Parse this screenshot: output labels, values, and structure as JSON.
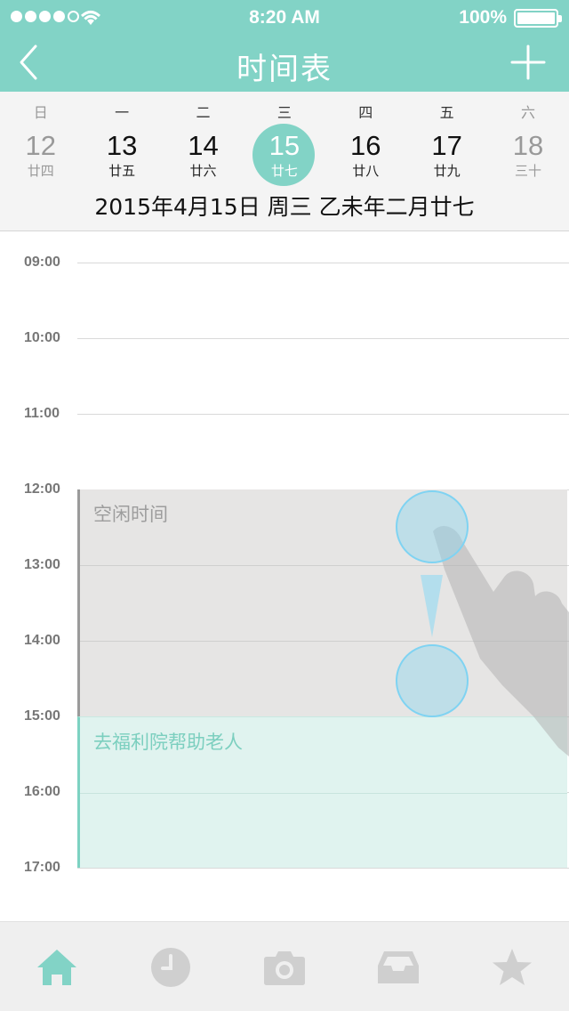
{
  "status_bar": {
    "time": "8:20 AM",
    "battery": "100%"
  },
  "header": {
    "title": "时间表"
  },
  "week": {
    "weekdays": [
      {
        "label": "日",
        "muted": true
      },
      {
        "label": "一",
        "muted": false
      },
      {
        "label": "二",
        "muted": false
      },
      {
        "label": "三",
        "muted": false
      },
      {
        "label": "四",
        "muted": false
      },
      {
        "label": "五",
        "muted": false
      },
      {
        "label": "六",
        "muted": true
      }
    ],
    "days": [
      {
        "num": "12",
        "lunar": "廿四",
        "muted": true,
        "selected": false
      },
      {
        "num": "13",
        "lunar": "廿五",
        "muted": false,
        "selected": false
      },
      {
        "num": "14",
        "lunar": "廿六",
        "muted": false,
        "selected": false
      },
      {
        "num": "15",
        "lunar": "廿七",
        "muted": false,
        "selected": true
      },
      {
        "num": "16",
        "lunar": "廿八",
        "muted": false,
        "selected": false
      },
      {
        "num": "17",
        "lunar": "廿九",
        "muted": false,
        "selected": false
      },
      {
        "num": "18",
        "lunar": "三十",
        "muted": true,
        "selected": false
      }
    ],
    "full_date": "2015年4月15日 周三   乙未年二月廿七"
  },
  "timeline": {
    "hours": [
      "09:00",
      "10:00",
      "11:00",
      "12:00",
      "13:00",
      "14:00",
      "15:00",
      "16:00",
      "17:00"
    ],
    "events": {
      "free": {
        "title": "空闲时间"
      },
      "charity": {
        "title": "去福利院帮助老人"
      }
    }
  },
  "tabbar": {
    "tabs": [
      "home-icon",
      "clock-icon",
      "camera-icon",
      "inbox-icon",
      "star-icon"
    ]
  },
  "colors": {
    "accent": "#82d3c6",
    "free_block": "#e6e5e4",
    "charity_block": "#e0f3ef",
    "gesture_circle": "#8fd5ee"
  }
}
